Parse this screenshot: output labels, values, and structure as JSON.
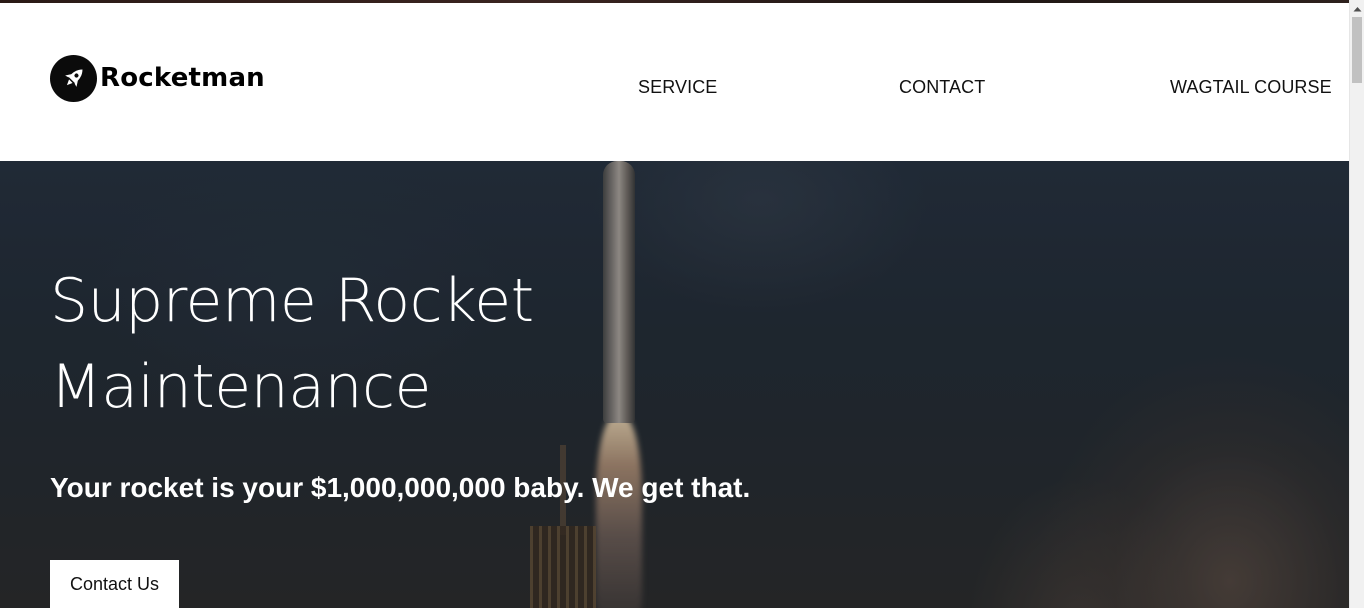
{
  "header": {
    "logo_text": "Rocketman",
    "nav": {
      "service": "SERVICE",
      "contact": "CONTACT",
      "course": "WAGTAIL COURSE"
    }
  },
  "hero": {
    "title_line1": "Supreme Rocket",
    "title_line2": "Maintenance",
    "subtitle": "Your rocket is your $1,000,000,000 baby. We get that.",
    "cta_label": "Contact Us",
    "background_image": "rocket-launch-photo"
  },
  "icons": {
    "logo": "rocket-icon",
    "scroll_up": "scroll-up-arrow-icon"
  },
  "colors": {
    "header_bg": "#ffffff",
    "hero_overlay": "#23262c",
    "text_light": "#ffffff",
    "text_dark": "#111111"
  }
}
